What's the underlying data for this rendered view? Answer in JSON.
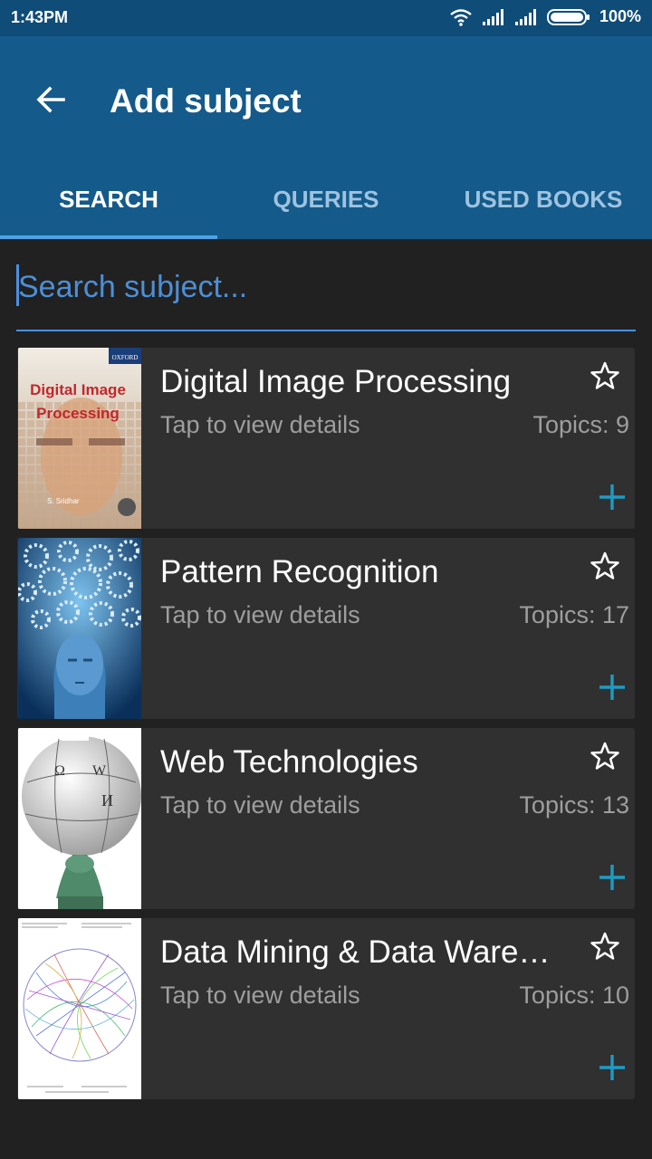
{
  "status_bar": {
    "time": "1:43PM",
    "battery": "100%"
  },
  "app_bar": {
    "title": "Add subject"
  },
  "tabs": [
    {
      "label": "SEARCH",
      "active": true
    },
    {
      "label": "QUERIES",
      "active": false
    },
    {
      "label": "USED BOOKS",
      "active": false
    }
  ],
  "search": {
    "placeholder": "Search subject...",
    "value": ""
  },
  "subjects": [
    {
      "title": "Digital Image Processing",
      "subtitle": "Tap to view details",
      "topics": "Topics: 9",
      "cover_title": "Digital Image Processing",
      "cover_publisher": "OXFORD",
      "cover_author": "S. Sridhar"
    },
    {
      "title": "Pattern Recognition",
      "subtitle": "Tap to view details",
      "topics": "Topics: 17"
    },
    {
      "title": "Web Technologies",
      "subtitle": "Tap to view details",
      "topics": "Topics: 13"
    },
    {
      "title": "Data Mining & Data Ware…",
      "subtitle": "Tap to view details",
      "topics": "Topics: 10"
    }
  ],
  "colors": {
    "status_bar": "#0f4c78",
    "app_bar": "#145a8a",
    "accent": "#4aa3e8",
    "plus": "#1e9bc4",
    "card": "#303030",
    "background": "#212121"
  }
}
